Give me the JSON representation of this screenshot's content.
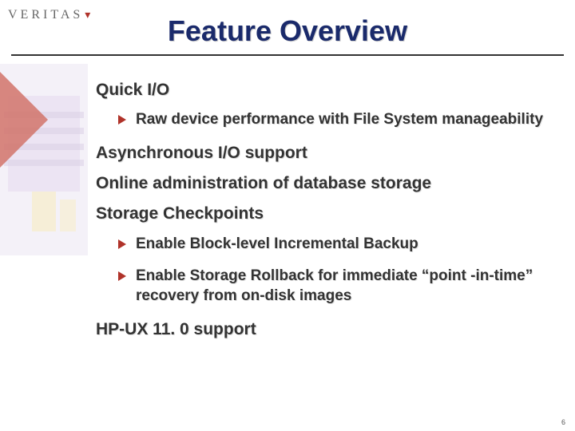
{
  "logo": {
    "text": "VERITAS"
  },
  "title": "Feature Overview",
  "points": [
    {
      "text": "Quick I/O",
      "subs": [
        "Raw device performance with File System manageability"
      ]
    },
    {
      "text": "Asynchronous I/O support",
      "subs": []
    },
    {
      "text": "Online administration of database storage",
      "subs": []
    },
    {
      "text": "Storage Checkpoints",
      "subs": [
        "Enable Block-level Incremental Backup",
        "Enable Storage Rollback for immediate “point -in-time” recovery from on-disk images"
      ]
    },
    {
      "text": "HP-UX 11. 0 support",
      "subs": []
    }
  ],
  "page_number": "6"
}
